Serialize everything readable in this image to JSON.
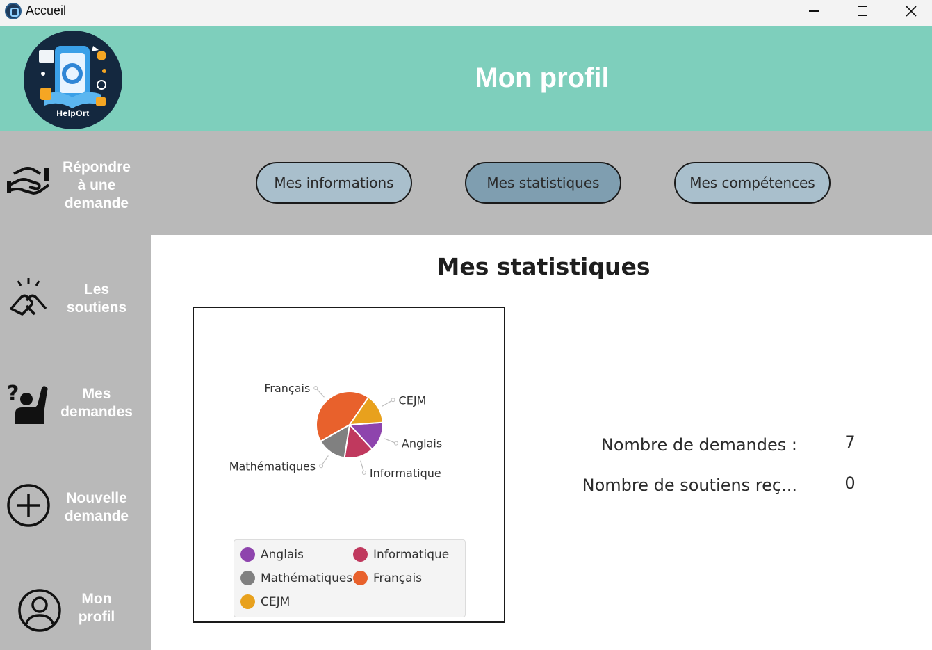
{
  "window": {
    "title": "Accueil",
    "icon": "helport-app-icon",
    "controls": [
      "minimize-icon",
      "maximize-icon",
      "close-icon"
    ]
  },
  "header": {
    "title": "Mon profil",
    "logo_text": "HelpOrt",
    "background": "#7ecfbc"
  },
  "sidebar": {
    "background": "#b9b9b9",
    "items": [
      {
        "label": "Répondre\nà une\ndemande",
        "icon": "handshake-help-icon"
      },
      {
        "label": "Les\nsoutiens",
        "icon": "clasped-hands-icon"
      },
      {
        "label": "Mes\ndemandes",
        "icon": "question-person-icon"
      },
      {
        "label": "Nouvelle\ndemande",
        "icon": "plus-circle-icon"
      },
      {
        "label": "Mon\nprofil",
        "icon": "user-circle-icon"
      }
    ]
  },
  "tabs": [
    {
      "label": "Mes informations",
      "active": false
    },
    {
      "label": "Mes statistiques",
      "active": true
    },
    {
      "label": "Mes compétences",
      "active": false
    }
  ],
  "main": {
    "title": "Mes statistiques",
    "stats": [
      {
        "label": "Nombre de demandes :",
        "value": "7"
      },
      {
        "label": "Nombre de soutiens reç...",
        "value": "0"
      }
    ]
  },
  "chart_data": {
    "type": "pie",
    "slices": [
      {
        "name": "Anglais",
        "value": 1,
        "color": "#8e44ad"
      },
      {
        "name": "Informatique",
        "value": 1,
        "color": "#c0395e"
      },
      {
        "name": "Mathématiques",
        "value": 1,
        "color": "#808080"
      },
      {
        "name": "Français",
        "value": 3,
        "color": "#e8612c"
      },
      {
        "name": "CEJM",
        "value": 1,
        "color": "#e8a11d"
      }
    ],
    "legend": "bottom"
  }
}
